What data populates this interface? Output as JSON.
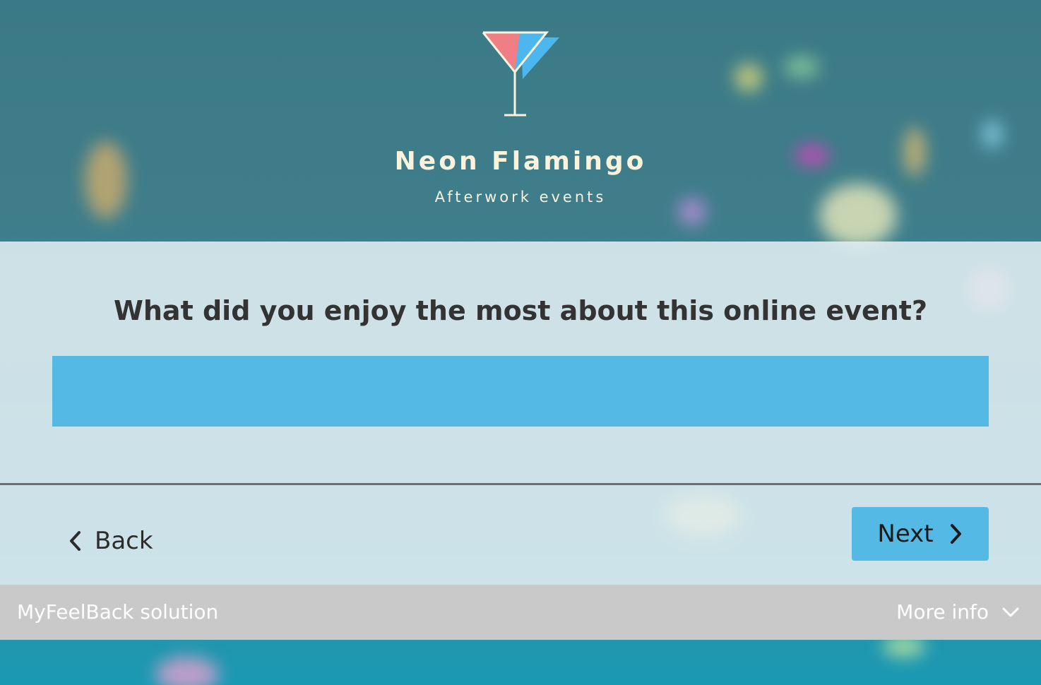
{
  "brand": {
    "title": "Neon Flamingo",
    "subtitle": "Afterwork events",
    "logo_icon": "cocktail-glass-icon"
  },
  "survey": {
    "question": "What did you enjoy the most about this online event?",
    "answer_value": "",
    "answer_placeholder": ""
  },
  "navigation": {
    "back_label": "Back",
    "next_label": "Next"
  },
  "footer": {
    "brand_label": "MyFeelBack solution",
    "more_info_label": "More info"
  },
  "colors": {
    "accent": "#55b9e6",
    "panel": "#e1eef2",
    "footer": "#c9c9c9",
    "brand_text": "#fbf2dc"
  }
}
